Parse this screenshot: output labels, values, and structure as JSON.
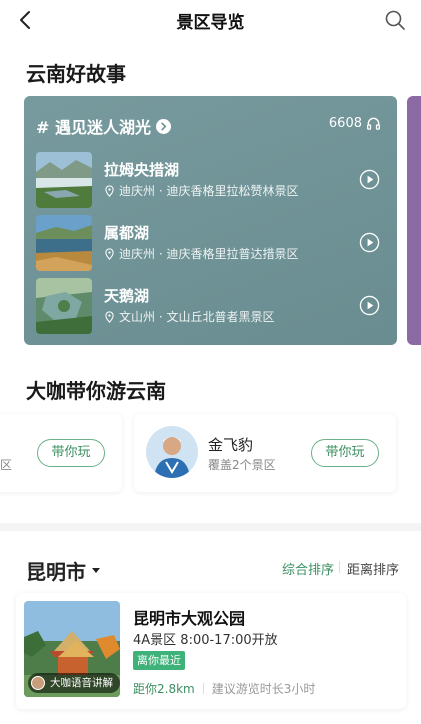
{
  "nav": {
    "title": "景区导览",
    "back_icon": "back-arrow-icon",
    "search_icon": "search-icon"
  },
  "stories": {
    "section_title": "云南好故事",
    "topic": "# 遇见迷人湖光",
    "listen_count": "6608",
    "items": [
      {
        "name": "拉姆央措湖",
        "location": "迪庆州 · 迪庆香格里拉松赞林景区"
      },
      {
        "name": "属都湖",
        "location": "迪庆州 · 迪庆香格里拉普达措景区"
      },
      {
        "name": "天鹅湖",
        "location": "文山州 · 文山丘北普者黑景区"
      }
    ],
    "card_color": "#6f9498"
  },
  "guides": {
    "section_title": "大咖带你游云南",
    "left_partial": {
      "sub_fragment": "区",
      "button": "带你玩"
    },
    "items": [
      {
        "name": "金飞豹",
        "coverage": "覆盖2个景区",
        "button": "带你玩"
      }
    ]
  },
  "city": {
    "name": "昆明市",
    "sort_options": [
      "综合排序",
      "距离排序"
    ],
    "active_sort": "综合排序",
    "spots": [
      {
        "name": "昆明市大观公园",
        "info": "4A景区  8:00-17:00开放",
        "tag": "离你最近",
        "distance": "距你2.8km",
        "suggestion": "建议游览时长3小时",
        "badge": "大咖语音讲解"
      }
    ]
  },
  "colors": {
    "accent_green": "#3c8f62",
    "tag_green": "#3fb27a",
    "divider": "#f4f4f4"
  }
}
